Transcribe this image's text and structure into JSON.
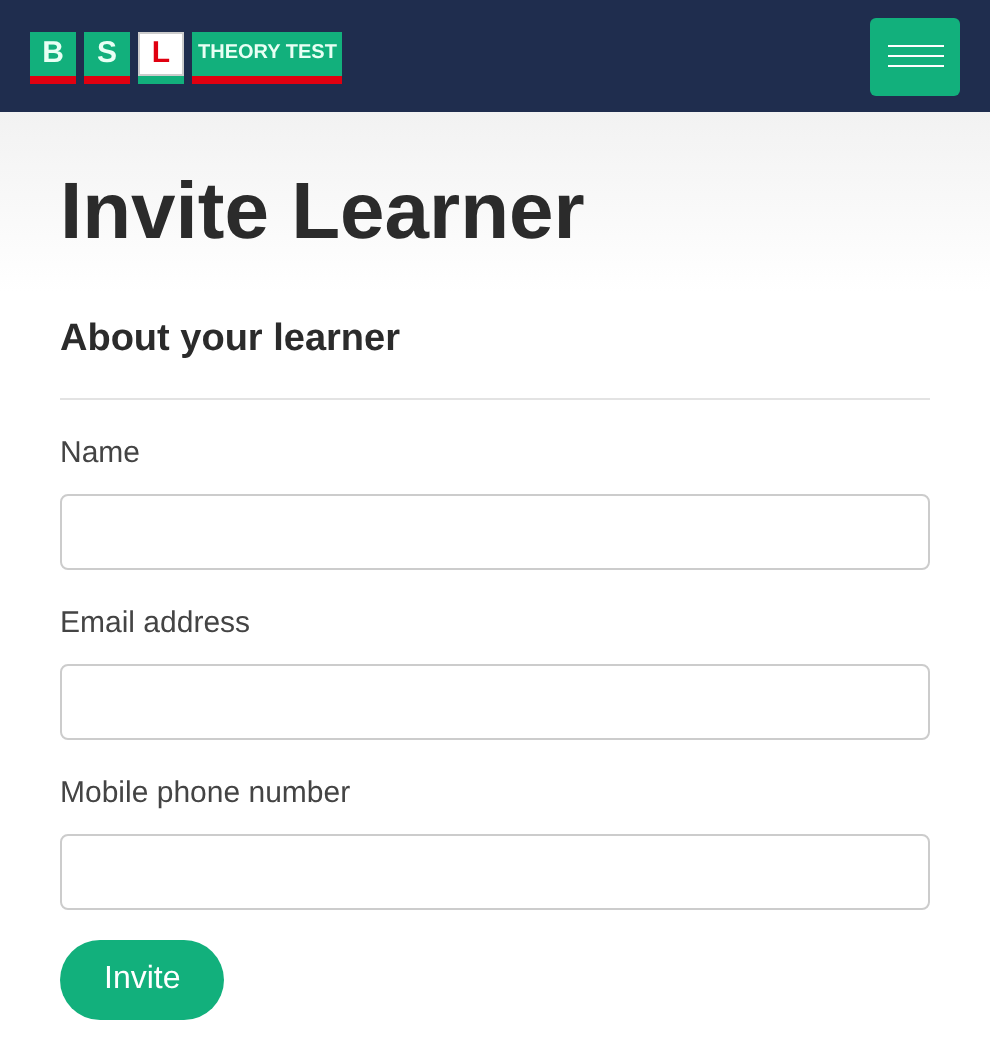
{
  "header": {
    "logo": [
      {
        "text": "B",
        "kind": "green"
      },
      {
        "text": "S",
        "kind": "green"
      },
      {
        "text": "L",
        "kind": "plate"
      },
      {
        "text": "THEORY TEST",
        "kind": "wide"
      }
    ]
  },
  "page": {
    "title": "Invite Learner",
    "section": "About your learner",
    "fields": [
      {
        "label": "Name"
      },
      {
        "label": "Email address"
      },
      {
        "label": "Mobile phone number"
      }
    ],
    "submit": "Invite"
  }
}
